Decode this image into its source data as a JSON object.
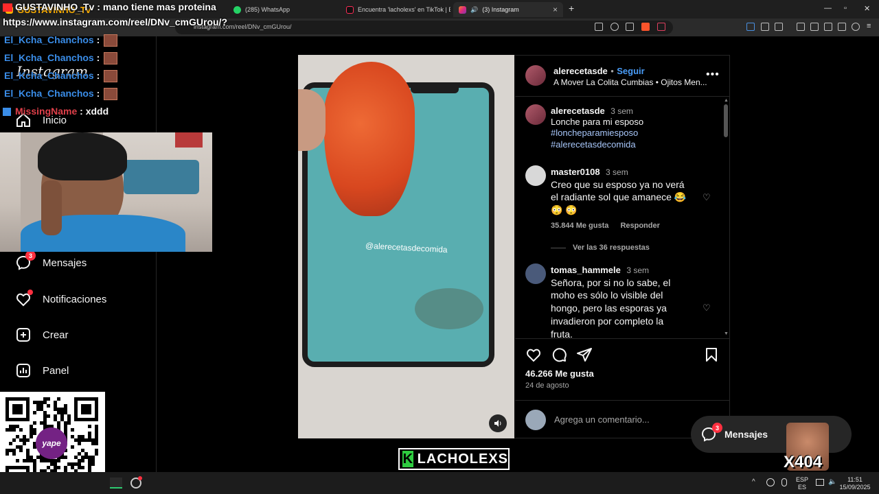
{
  "browser": {
    "tabs": [
      {
        "label": "GUSTAVINHO_Tv",
        "icon": "red-square-icon"
      },
      {
        "label": "(285) WhatsApp",
        "icon": "whatsapp-icon"
      },
      {
        "label": "Encuentra 'lacholexs' en TikTok | Bus",
        "icon": "tiktok-icon"
      },
      {
        "label": "(3) Instagram",
        "icon": "instagram-icon"
      }
    ],
    "url": "instagram.com/reel/DNv_cmGUrou/"
  },
  "overlay": {
    "stream_title": "GUSTAVINHO_Tv : mano tiene mas proteina",
    "stream_url": "https://www.instagram.com/reel/DNv_cmGUrou/?",
    "chat": [
      {
        "user": "El_Kcha_Chanchos",
        "sep": " :"
      },
      {
        "user": "El_Kcha_Chanchos",
        "sep": " :"
      },
      {
        "user": "El_Kcha_Chanchos",
        "sep": " :"
      },
      {
        "user": "El_Kcha_Chanchos",
        "sep": " :"
      },
      {
        "user": "MissingName",
        "sep": " : xddd"
      }
    ],
    "colors": {
      "chat_user": "#3a8de8",
      "missing_user": "#e0404a",
      "title_user": "#ff4a3a"
    }
  },
  "ig_nav": {
    "logo": "Instagram",
    "home_label": "Inicio",
    "messages_label": "Mensajes",
    "messages_badge": "3",
    "notifications_label": "Notificaciones",
    "create_label": "Crear",
    "panel_label": "Panel"
  },
  "qr": {
    "brand": "yape"
  },
  "post": {
    "author": "alerecetasde",
    "follow": "Seguir",
    "dot": "•",
    "audio": "A Mover La Colita Cumbias • Ojitos Men...",
    "media_watermark": "@alerecetasdecomida",
    "caption": {
      "user": "alerecetasde",
      "time": "3 sem",
      "text": "Lonche para mi esposo",
      "tags": [
        "#loncheparamiesposo",
        "#alerecetasdecomida"
      ]
    },
    "comments": [
      {
        "user": "master0108",
        "time": "3 sem",
        "lines": [
          "Creo que su esposo ya no verá",
          "el radiante sol que amanece 😂",
          "😳 😳"
        ],
        "likes": "35.844 Me gusta",
        "reply": "Responder",
        "view_replies": "Ver las 36 respuestas"
      },
      {
        "user": "tomas_hammele",
        "time": "3 sem",
        "lines": [
          "Señora, por si no lo sabe, el",
          "moho es sólo lo visible del",
          "hongo, pero las esporas ya",
          "invadieron por completo la",
          "fruta."
        ]
      }
    ],
    "likes": "46.266 Me gusta",
    "date": "24 de agosto",
    "comment_placeholder": "Agrega un comentario..."
  },
  "messages_float": {
    "label": "Mensajes",
    "badge": "3"
  },
  "stream_logo": "LACHOLEXS",
  "sticker_text": "X404",
  "taskbar": {
    "lang_top": "ESP",
    "lang_bottom": "ES",
    "time": "11:51",
    "date": "15/09/2025"
  }
}
